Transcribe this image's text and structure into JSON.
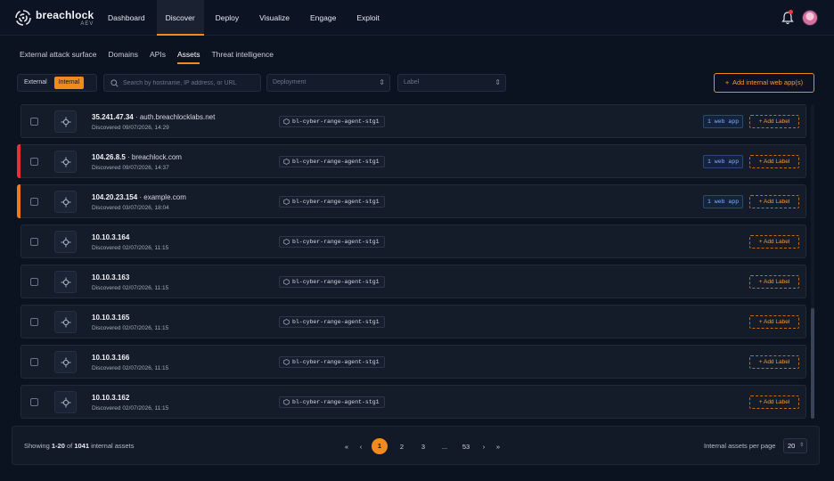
{
  "brand": {
    "name": "breachlock",
    "sub": "AEV"
  },
  "nav": [
    {
      "label": "Dashboard",
      "active": false
    },
    {
      "label": "Discover",
      "active": true
    },
    {
      "label": "Deploy",
      "active": false
    },
    {
      "label": "Visualize",
      "active": false
    },
    {
      "label": "Engage",
      "active": false
    },
    {
      "label": "Exploit",
      "active": false
    }
  ],
  "subtabs": [
    {
      "label": "External attack surface",
      "active": false
    },
    {
      "label": "Domains",
      "active": false
    },
    {
      "label": "APIs",
      "active": false
    },
    {
      "label": "Assets",
      "active": true
    },
    {
      "label": "Threat intelligence",
      "active": false
    }
  ],
  "filters": {
    "external": "External",
    "internal": "Internal",
    "search_placeholder": "Search by hostname, IP address, or URL",
    "deployment_placeholder": "Deployment",
    "label_placeholder": "Label",
    "add_button": "Add internal web app(s)"
  },
  "colors": {
    "accent": "#f28a1e",
    "critical": "#e5303a",
    "high": "#f07a1a"
  },
  "assets": [
    {
      "ip": "35.241.47.34",
      "host": " · auth.breachlocklabs.net",
      "discovered": "Discovered 09/07/2026, 14:29",
      "agent": "bl-cyber-range-agent-stg1",
      "webapps": "1 web app",
      "add_label": "+ Add Label",
      "severity": ""
    },
    {
      "ip": "104.26.8.5",
      "host": " · breachlock.com",
      "discovered": "Discovered 09/07/2026, 14:37",
      "agent": "bl-cyber-range-agent-stg1",
      "webapps": "1 web app",
      "add_label": "+ Add Label",
      "severity": "critical"
    },
    {
      "ip": "104.20.23.154",
      "host": " · example.com",
      "discovered": "Discovered 03/07/2026, 18:04",
      "agent": "bl-cyber-range-agent-stg1",
      "webapps": "1 web app",
      "add_label": "+ Add Label",
      "severity": "high"
    },
    {
      "ip": "10.10.3.164",
      "host": "",
      "discovered": "Discovered 02/07/2026, 11:15",
      "agent": "bl-cyber-range-agent-stg1",
      "webapps": "",
      "add_label": "+ Add Label",
      "severity": ""
    },
    {
      "ip": "10.10.3.163",
      "host": "",
      "discovered": "Discovered 02/07/2026, 11:15",
      "agent": "bl-cyber-range-agent-stg1",
      "webapps": "",
      "add_label": "+ Add Label",
      "severity": ""
    },
    {
      "ip": "10.10.3.165",
      "host": "",
      "discovered": "Discovered 02/07/2026, 11:15",
      "agent": "bl-cyber-range-agent-stg1",
      "webapps": "",
      "add_label": "+ Add Label",
      "severity": ""
    },
    {
      "ip": "10.10.3.166",
      "host": "",
      "discovered": "Discovered 02/07/2026, 11:15",
      "agent": "bl-cyber-range-agent-stg1",
      "webapps": "",
      "add_label": "+ Add Label",
      "severity": ""
    },
    {
      "ip": "10.10.3.162",
      "host": "",
      "discovered": "Discovered 02/07/2026, 11:15",
      "agent": "bl-cyber-range-agent-stg1",
      "webapps": "",
      "add_label": "+ Add Label",
      "severity": ""
    }
  ],
  "footer": {
    "showing_prefix": "Showing ",
    "showing_range": "1-20",
    "showing_of": " of ",
    "showing_total": "1041",
    "showing_suffix": " internal assets",
    "pages": [
      "1",
      "2",
      "3",
      "...",
      "53"
    ],
    "current_page": "1",
    "first": "«",
    "prev": "‹",
    "next": "›",
    "last": "»",
    "per_page_label": "Internal assets per page",
    "per_page_value": "20"
  }
}
